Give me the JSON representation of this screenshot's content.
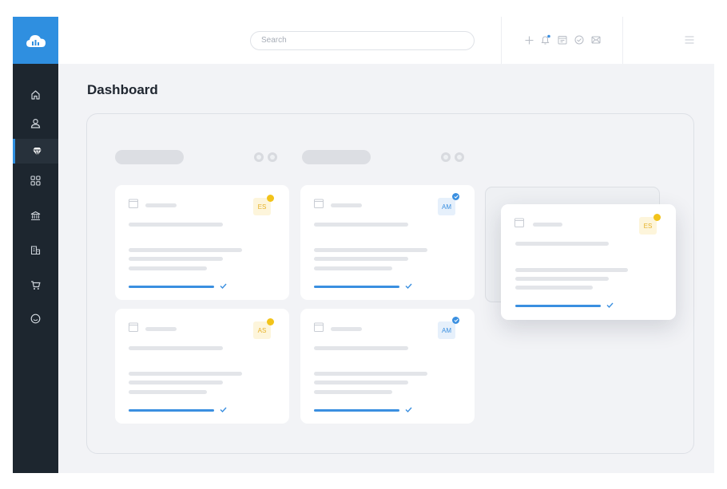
{
  "app": {
    "brand_color": "#2f8fe0",
    "sidebar_color": "#1d262f"
  },
  "sidebar": {
    "items": [
      {
        "icon": "home-icon",
        "active": false
      },
      {
        "icon": "user-icon",
        "active": false
      },
      {
        "icon": "diamond-icon",
        "active": true
      },
      {
        "icon": "grid-icon",
        "active": false
      },
      {
        "icon": "bank-icon",
        "active": false
      },
      {
        "icon": "store-icon",
        "active": false
      },
      {
        "icon": "cart-icon",
        "active": false
      },
      {
        "icon": "smile-icon",
        "active": false
      }
    ]
  },
  "topbar": {
    "search": {
      "placeholder": "Search"
    },
    "actions": [
      "plus-icon",
      "bell-icon",
      "calendar-icon",
      "check-circle-icon",
      "mail-icon"
    ],
    "menu_icon": "hamburger-icon"
  },
  "page": {
    "title": "Dashboard"
  },
  "cards": [
    {
      "initials": "ES",
      "badge": "yellow"
    },
    {
      "initials": "AM",
      "badge": "blue"
    },
    {
      "initials": "AS",
      "badge": "yellow"
    },
    {
      "initials": "AM",
      "badge": "blue"
    }
  ],
  "floating_card": {
    "initials": "ES",
    "badge": "yellow"
  }
}
